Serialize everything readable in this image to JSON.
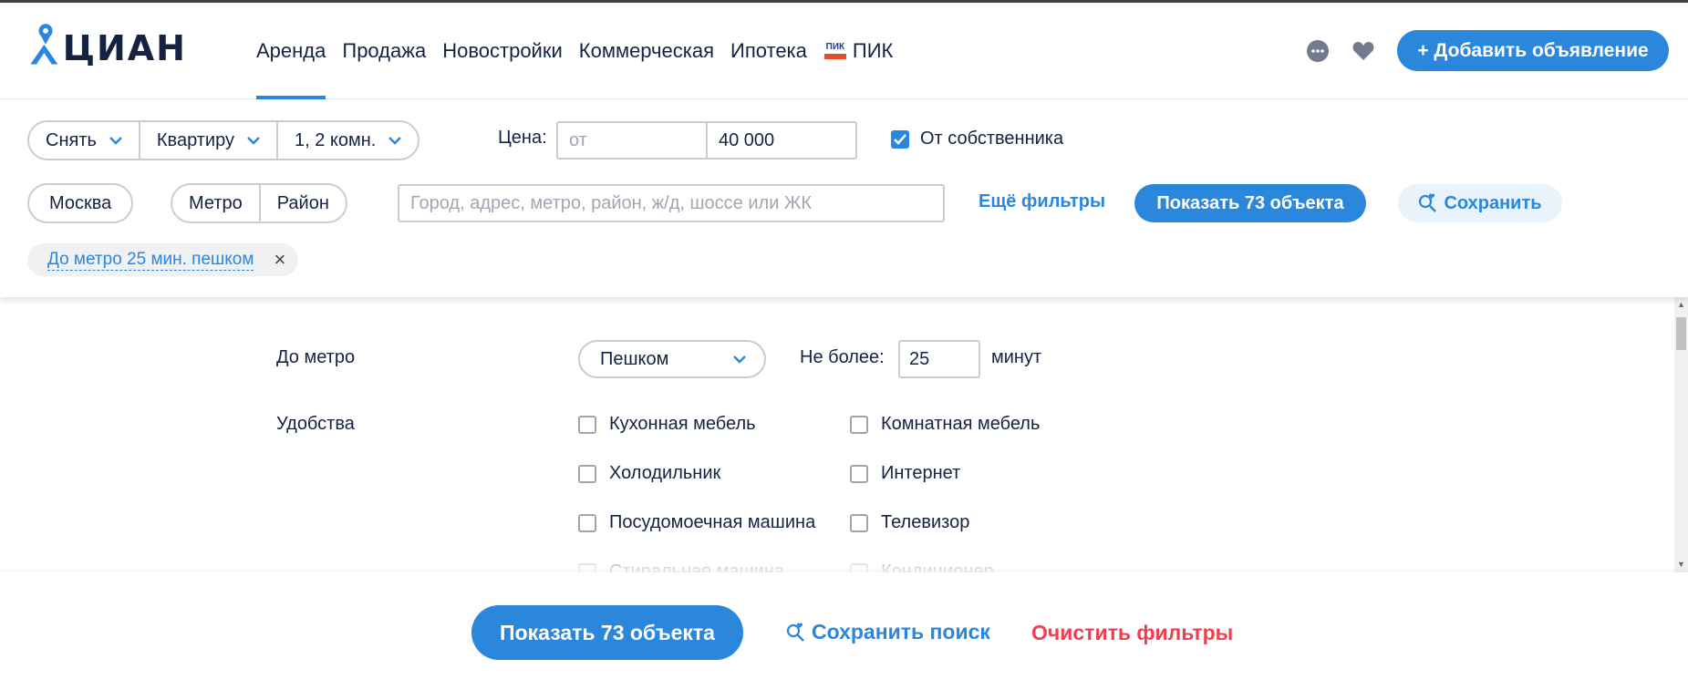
{
  "colors": {
    "accent": "#2b87db",
    "text": "#152242",
    "danger": "#ef3f4f",
    "border": "#c9ccd4"
  },
  "header": {
    "logo_text": "ЦИАН",
    "nav": [
      {
        "label": "Аренда",
        "active": true
      },
      {
        "label": "Продажа"
      },
      {
        "label": "Новостройки"
      },
      {
        "label": "Коммерческая"
      },
      {
        "label": "Ипотека"
      },
      {
        "label": "ПИК",
        "badge": "ПИК"
      }
    ],
    "icons": [
      "chat-icon",
      "heart-icon"
    ],
    "add_button": "+ Добавить объявление"
  },
  "filters": {
    "deal_type": "Снять",
    "object_type": "Квартиру",
    "rooms": "1, 2 комн.",
    "price_label": "Цена:",
    "price_from_placeholder": "от",
    "price_to": "40 000",
    "owner_checked": true,
    "owner_label": "От собственника",
    "city": "Москва",
    "metro": "Метро",
    "district": "Район",
    "search_placeholder": "Город, адрес, метро, район, ж/д, шоссе или ЖК",
    "more_filters": "Ещё фильтры",
    "show_button": "Показать 73 объекта",
    "save_button": "Сохранить",
    "chip": "До метро 25 мин. пешком",
    "chip_close": "×"
  },
  "details": {
    "metro_label": "До метро",
    "metro_mode": "Пешком",
    "not_more_label": "Не более:",
    "minutes_value": "25",
    "minutes_unit": "минут",
    "amenities_label": "Удобства",
    "amenities": [
      {
        "label": "Кухонная мебель",
        "checked": false
      },
      {
        "label": "Комнатная мебель",
        "checked": false
      },
      {
        "label": "Холодильник",
        "checked": false
      },
      {
        "label": "Интернет",
        "checked": false
      },
      {
        "label": "Посудомоечная машина",
        "checked": false
      },
      {
        "label": "Телевизор",
        "checked": false
      },
      {
        "label": "Стиральная машина",
        "checked": false
      },
      {
        "label": "Кондиционер",
        "checked": false
      }
    ]
  },
  "footer": {
    "show_button": "Показать 73 объекта",
    "save_search": "Сохранить поиск",
    "clear_filters": "Очистить фильтры"
  }
}
